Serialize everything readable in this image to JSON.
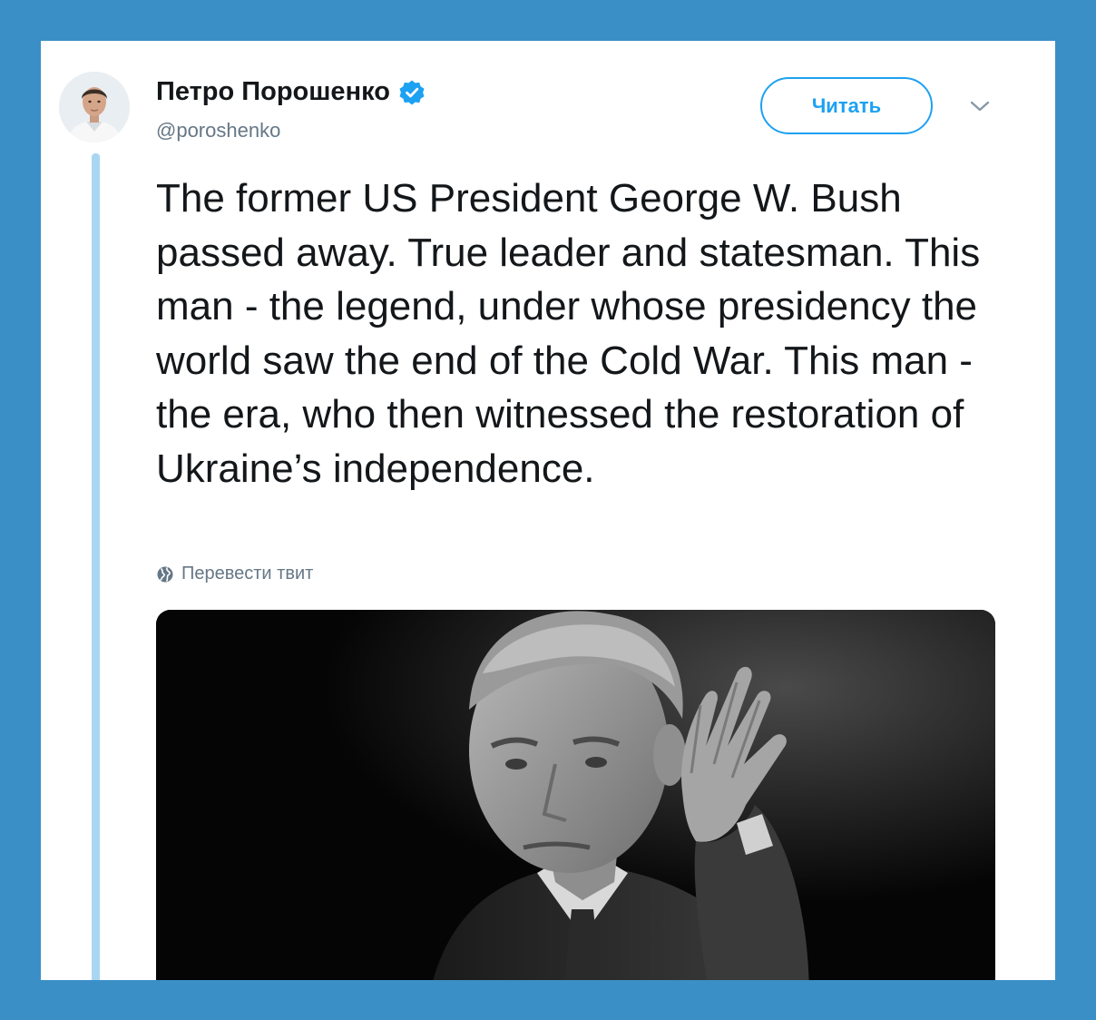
{
  "tweet": {
    "display_name": "Петро Порошенко",
    "handle": "@poroshenko",
    "follow_label": "Читать",
    "text": "The former US President George W. Bush passed away. True leader and statesman. This man - the legend, under whose presidency the world saw the end of the Cold War. This man - the era, who then witnessed the restoration of Ukraine’s independence.",
    "translate_label": "Перевести твит"
  },
  "icons": {
    "verified": "verified-badge-icon",
    "caret": "chevron-down-icon",
    "globe": "globe-icon"
  },
  "colors": {
    "frame": "#3a8fc6",
    "accent": "#1da1f2",
    "thread_line": "#a9d7f2",
    "text": "#14171a",
    "muted": "#657786"
  }
}
